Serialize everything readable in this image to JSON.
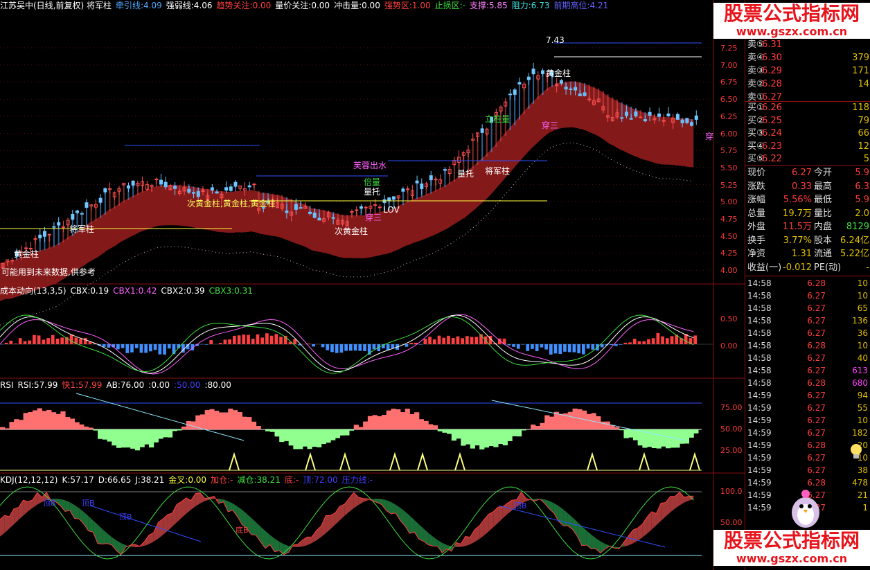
{
  "main": {
    "header": [
      {
        "text": "江苏吴中(日线,前复权) 将军柱",
        "color": "#ffffff"
      },
      {
        "text": "牵引线:4.09",
        "color": "#4fa8ff"
      },
      {
        "text": "强弱线:4.06",
        "color": "#ffffff"
      },
      {
        "text": "趋势关注:0.00",
        "color": "#ff4040"
      },
      {
        "text": "量价关注:0.00",
        "color": "#ffffff"
      },
      {
        "text": "冲击量:0.00",
        "color": "#ffffff"
      },
      {
        "text": "强势区:1.00",
        "color": "#ff4040"
      },
      {
        "text": "止损区:-",
        "color": "#3fe03f"
      },
      {
        "text": "支撑:5.85",
        "color": "#ff80ff"
      },
      {
        "text": "阻力:6.73",
        "color": "#3fe0e0"
      },
      {
        "text": "前期高位:4.21",
        "color": "#6060ff"
      }
    ],
    "y_ticks": [
      "7.25",
      "7.00",
      "6.75",
      "6.50",
      "6.25",
      "6.00",
      "5.75",
      "5.50",
      "5.25",
      "5.00",
      "4.75",
      "4.50",
      "4.25",
      "4.00"
    ],
    "annotations": [
      {
        "text": "黄金柱",
        "color": "#ffffff"
      },
      {
        "text": "将军柱",
        "color": "#ffffff"
      },
      {
        "text": "次黄金柱,黄金柱,黄金柱",
        "color": "#ffff60"
      },
      {
        "text": "次黄金柱",
        "color": "#ffffff"
      },
      {
        "text": "芙蓉出水",
        "color": "#ff60ff"
      },
      {
        "text": "倍量",
        "color": "#3fe03f"
      },
      {
        "text": "量托",
        "color": "#ffffff"
      },
      {
        "text": "穿三",
        "color": "#ff60ff"
      },
      {
        "text": "LOV",
        "color": "#ffffff"
      },
      {
        "text": "量托",
        "color": "#ffffff"
      },
      {
        "text": "将军柱",
        "color": "#ffffff"
      },
      {
        "text": "立桩量",
        "color": "#3fe03f"
      },
      {
        "text": "黄金柱",
        "color": "#ffffff"
      },
      {
        "text": "7.43",
        "color": "#ffffff"
      },
      {
        "text": "穿三",
        "color": "#ff60ff"
      },
      {
        "text": "穿",
        "color": "#ff60ff"
      }
    ],
    "note": "可能用到未来数据,供参考"
  },
  "cbx": {
    "header": [
      {
        "text": "成本动向(13,3,5)",
        "color": "#ffffff"
      },
      {
        "text": "CBX:0.19",
        "color": "#ffffff"
      },
      {
        "text": "CBX1:0.42",
        "color": "#ff60ff"
      },
      {
        "text": "CBX2:0.39",
        "color": "#ffffff"
      },
      {
        "text": "CBX3:0.31",
        "color": "#3fe03f"
      }
    ],
    "y_ticks": [
      "0.50",
      "0.00"
    ]
  },
  "rsi": {
    "header": [
      {
        "text": "RSI",
        "color": "#ffffff"
      },
      {
        "text": "RSI:57.99",
        "color": "#ffffff"
      },
      {
        "text": "快1:57.99",
        "color": "#ff4040"
      },
      {
        "text": "AB:76.00",
        "color": "#ffffff"
      },
      {
        "text": ":0.00",
        "color": "#ffffff"
      },
      {
        "text": ":50.00",
        "color": "#4040ff"
      },
      {
        "text": ":80.00",
        "color": "#ffffff"
      }
    ],
    "y_ticks": [
      "75.00",
      "50.00",
      "25.00"
    ]
  },
  "kdj": {
    "header": [
      {
        "text": "KDJ(12,12,12)",
        "color": "#ffffff"
      },
      {
        "text": "K:57.17",
        "color": "#ffffff"
      },
      {
        "text": "D:66.65",
        "color": "#ffffff"
      },
      {
        "text": "J:38.21",
        "color": "#ffffff"
      },
      {
        "text": "金叉:0.00",
        "color": "#ffff40"
      },
      {
        "text": "加仓:-",
        "color": "#ff4040"
      },
      {
        "text": "减仓:38.21",
        "color": "#3fe03f"
      },
      {
        "text": "底:-",
        "color": "#ff4040"
      },
      {
        "text": "顶:72.00",
        "color": "#4040ff"
      },
      {
        "text": "压力线:-",
        "color": "#4040ff"
      }
    ],
    "y_ticks": [
      "100.0",
      "50.00"
    ],
    "labels": [
      "顶B",
      "顶B",
      "顶B",
      "底B",
      "顶B"
    ]
  },
  "side": {
    "sell": [
      {
        "label": "卖⑤",
        "price": "6.31",
        "vol": ""
      },
      {
        "label": "卖④",
        "price": "6.30",
        "vol": "379"
      },
      {
        "label": "卖③",
        "price": "6.29",
        "vol": "171"
      },
      {
        "label": "卖②",
        "price": "6.28",
        "vol": "14"
      },
      {
        "label": "卖①",
        "price": "6.27",
        "vol": ""
      }
    ],
    "buy": [
      {
        "label": "买①",
        "price": "6.26",
        "vol": "118"
      },
      {
        "label": "买②",
        "price": "6.25",
        "vol": "79"
      },
      {
        "label": "买③",
        "price": "6.24",
        "vol": "66"
      },
      {
        "label": "买④",
        "price": "6.23",
        "vol": "12"
      },
      {
        "label": "买⑤",
        "price": "6.22",
        "vol": "5"
      }
    ],
    "stats": [
      {
        "l1": "现价",
        "v1": "6.27",
        "c1": "#ff3b3b",
        "l2": "今开",
        "v2": "5.9",
        "c2": "#ff3b3b"
      },
      {
        "l1": "涨跌",
        "v1": "0.33",
        "c1": "#ff3b3b",
        "l2": "最高",
        "v2": "6.3",
        "c2": "#ff3b3b"
      },
      {
        "l1": "涨幅",
        "v1": "5.56%",
        "c1": "#ff3b3b",
        "l2": "最低",
        "v2": "5.9",
        "c2": "#ff3b3b"
      },
      {
        "l1": "总量",
        "v1": "19.7万",
        "c1": "#e0c000",
        "l2": "量比",
        "v2": "2.0",
        "c2": "#e0c000"
      },
      {
        "l1": "外盘",
        "v1": "11.5万",
        "c1": "#ff3b3b",
        "l2": "内盘",
        "v2": "8129",
        "c2": "#3fe03f"
      },
      {
        "l1": "换手",
        "v1": "3.77%",
        "c1": "#e0c000",
        "l2": "股本",
        "v2": "6.24亿",
        "c2": "#e0c000"
      },
      {
        "l1": "净资",
        "v1": "1.31",
        "c1": "#e0c000",
        "l2": "流通",
        "v2": "5.22亿",
        "c2": "#e0c000"
      },
      {
        "l1": "收益(一)",
        "v1": "-0.012",
        "c1": "#e0c000",
        "l2": "PE(动)",
        "v2": "-",
        "c2": "#e0c000"
      }
    ],
    "ticks": [
      {
        "t": "14:58",
        "p": "6.28",
        "q": "10",
        "qc": "#e0c000"
      },
      {
        "t": "14:58",
        "p": "6.27",
        "q": "10",
        "qc": "#e0c000"
      },
      {
        "t": "14:58",
        "p": "6.27",
        "q": "65",
        "qc": "#e0c000"
      },
      {
        "t": "14:58",
        "p": "6.27",
        "q": "136",
        "qc": "#e0c000"
      },
      {
        "t": "14:58",
        "p": "6.27",
        "q": "36",
        "qc": "#e0c000"
      },
      {
        "t": "14:58",
        "p": "6.28",
        "q": "10",
        "qc": "#e0c000"
      },
      {
        "t": "14:58",
        "p": "6.27",
        "q": "40",
        "qc": "#e0c000"
      },
      {
        "t": "14:58",
        "p": "6.27",
        "q": "613",
        "qc": "#ff40ff"
      },
      {
        "t": "14:58",
        "p": "6.28",
        "q": "680",
        "qc": "#ff40ff"
      },
      {
        "t": "14:59",
        "p": "6.27",
        "q": "94",
        "qc": "#e0c000"
      },
      {
        "t": "14:59",
        "p": "6.27",
        "q": "55",
        "qc": "#e0c000"
      },
      {
        "t": "14:59",
        "p": "6.27",
        "q": "10",
        "qc": "#e0c000"
      },
      {
        "t": "14:59",
        "p": "6.27",
        "q": "182",
        "qc": "#e0c000"
      },
      {
        "t": "14:59",
        "p": "6.28",
        "q": "20",
        "qc": "#e0c000"
      },
      {
        "t": "14:59",
        "p": "6.27",
        "q": "10",
        "qc": "#e0c000"
      },
      {
        "t": "14:59",
        "p": "6.27",
        "q": "38",
        "qc": "#e0c000"
      },
      {
        "t": "14:59",
        "p": "6.28",
        "q": "478",
        "qc": "#e0c000"
      },
      {
        "t": "14:59",
        "p": "6.27",
        "q": "21",
        "qc": "#e0c000"
      },
      {
        "t": "14:59",
        "p": "6.27",
        "q": "1",
        "qc": "#e0c000"
      }
    ]
  },
  "watermark": {
    "title": "股票公式指标网",
    "url": "www.gszx.com.cn"
  }
}
